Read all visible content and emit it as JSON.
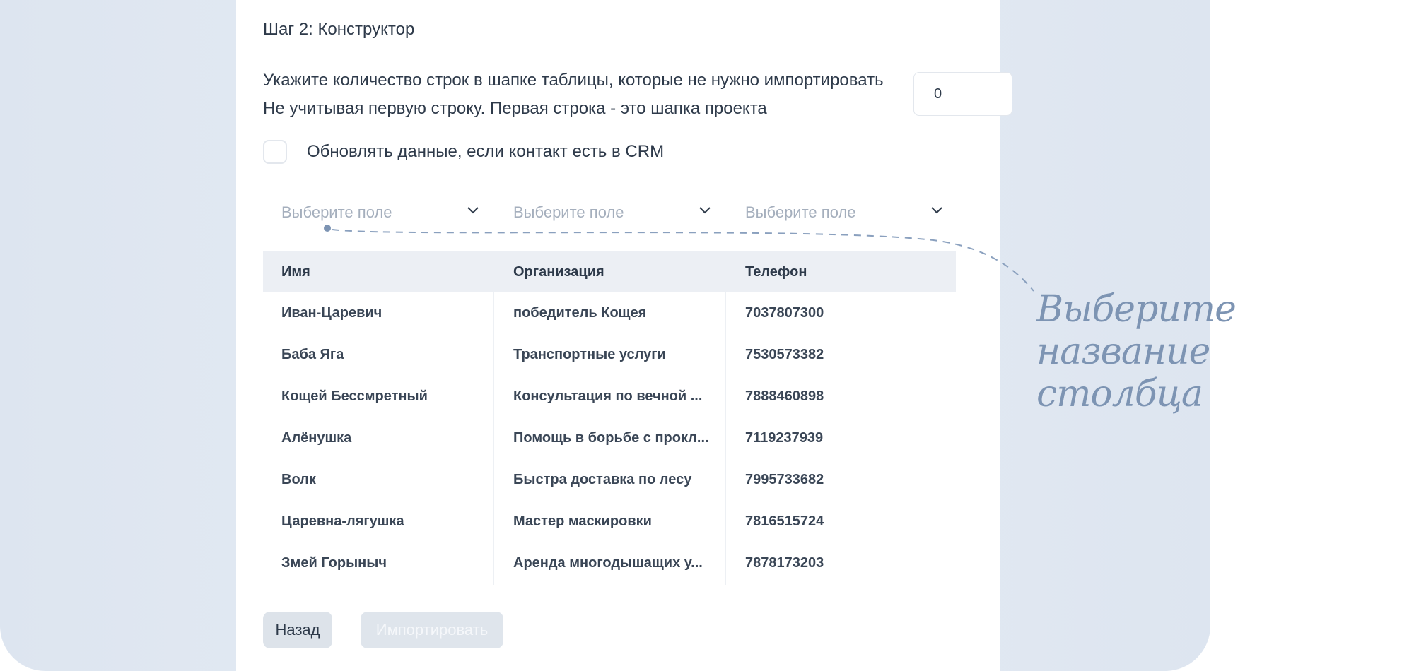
{
  "step_title": "Шаг 2: Конструктор",
  "instructions": {
    "line1": "Укажите количество строк в шапке таблицы, которые не нужно импортировать",
    "line2": "Не учитывая первую строку. Первая строка - это шапка проекта"
  },
  "skip_rows_input": {
    "value": "0"
  },
  "update_checkbox": {
    "label": "Обновлять данные, если контакт есть в CRM",
    "checked": false
  },
  "field_selects": [
    {
      "placeholder": "Выберите поле"
    },
    {
      "placeholder": "Выберите поле"
    },
    {
      "placeholder": "Выберите поле"
    }
  ],
  "table": {
    "headers": [
      "Имя",
      "Организация",
      "Телефон"
    ],
    "rows": [
      [
        "Иван-Царевич",
        "победитель Кощея",
        "7037807300"
      ],
      [
        "Баба Яга",
        "Транспортные услуги",
        "7530573382"
      ],
      [
        "Кощей Бессмретный",
        "Консультация по вечной ...",
        "7888460898"
      ],
      [
        "Алёнушка",
        "Помощь в борьбе с прокл...",
        "7119237939"
      ],
      [
        "Волк",
        "Быстра доставка по лесу",
        "7995733682"
      ],
      [
        "Царевна-лягушка",
        "Мастер маскировки",
        "7816515724"
      ],
      [
        "Змей Горыныч",
        "Аренда многодышащих у...",
        "7878173203"
      ]
    ]
  },
  "buttons": {
    "back": "Назад",
    "import": "Импортировать"
  },
  "hint": {
    "line1": "Выберите название",
    "line2": "столбца"
  },
  "colors": {
    "accent": "#7d94b3",
    "text": "#2e3a4a",
    "placeholder": "#a5afbd",
    "header_bg": "#eceff4",
    "background": "#dde5f0"
  }
}
